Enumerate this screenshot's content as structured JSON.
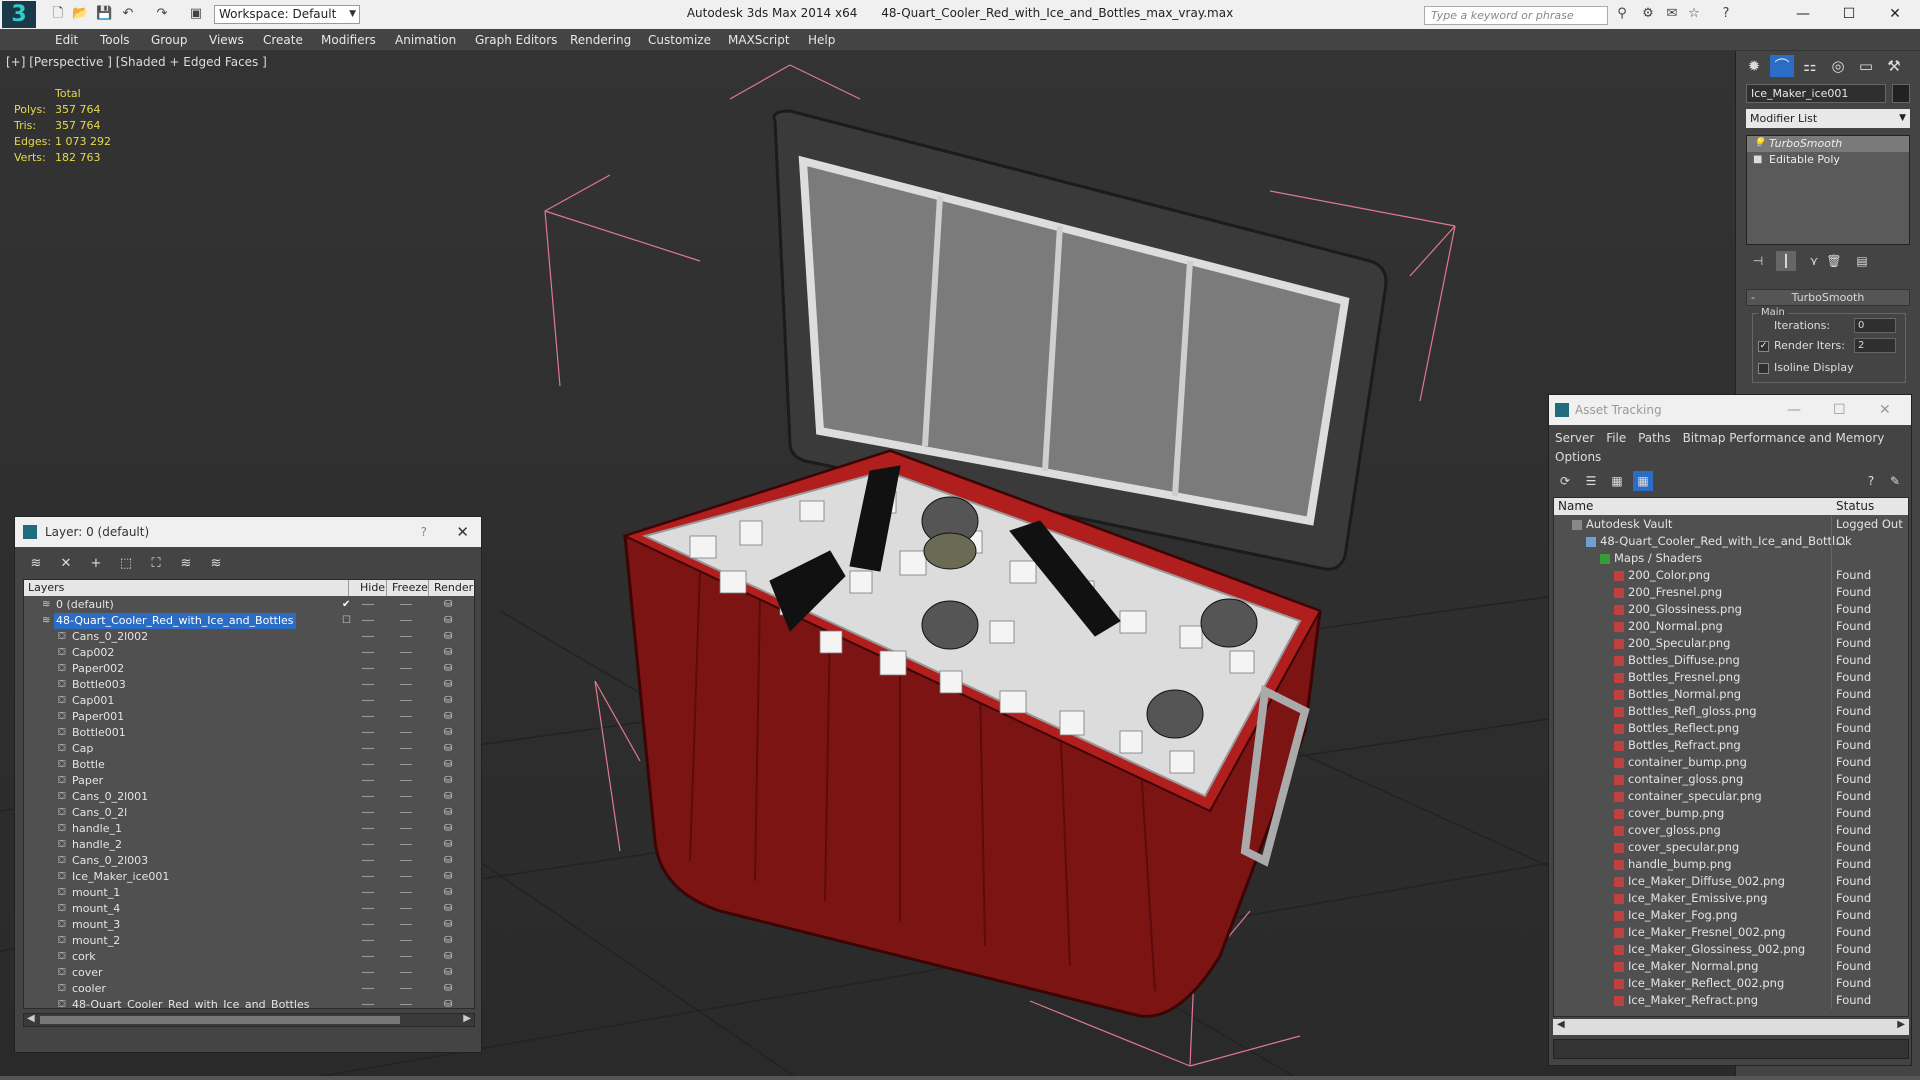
{
  "titlebar": {
    "workspace": "Workspace: Default",
    "app_name": "Autodesk 3ds Max  2014 x64",
    "file_name": "48-Quart_Cooler_Red_with_Ice_and_Bottles_max_vray.max",
    "search_placeholder": "Type a keyword or phrase"
  },
  "menu": [
    "Edit",
    "Tools",
    "Group",
    "Views",
    "Create",
    "Modifiers",
    "Animation",
    "Graph Editors",
    "Rendering",
    "Customize",
    "MAXScript",
    "Help"
  ],
  "viewport": {
    "label": "[+] [Perspective ] [Shaded + Edged Faces ]",
    "stats": {
      "header": "Total",
      "rows": [
        {
          "label": "Polys:",
          "value": "357 764"
        },
        {
          "label": "Tris:",
          "value": "357 764"
        },
        {
          "label": "Edges:",
          "value": "1 073 292"
        },
        {
          "label": "Verts:",
          "value": "182 763"
        }
      ]
    }
  },
  "command_panel": {
    "object_name": "Ice_Maker_ice001",
    "modifier_list": "Modifier List",
    "stack": [
      {
        "label": "TurboSmooth",
        "selected": true
      },
      {
        "label": "Editable Poly",
        "selected": false
      }
    ],
    "rollout_title": "TurboSmooth",
    "group_main": "Main",
    "iterations_label": "Iterations:",
    "iterations_value": "0",
    "render_iters_label": "Render Iters:",
    "render_iters_value": "2",
    "isoline_label": "Isoline Display"
  },
  "layer_dialog": {
    "title": "Layer: 0 (default)",
    "help": "?",
    "columns": {
      "layers": "Layers",
      "hide": "Hide",
      "freeze": "Freeze",
      "render": "Render"
    },
    "rows": [
      {
        "name": "0 (default)",
        "level": 0,
        "selected": false,
        "current": true
      },
      {
        "name": "48-Quart_Cooler_Red_with_Ice_and_Bottles",
        "level": 0,
        "selected": true,
        "current": false
      },
      {
        "name": "Cans_0_2l002",
        "level": 1
      },
      {
        "name": "Cap002",
        "level": 1
      },
      {
        "name": "Paper002",
        "level": 1
      },
      {
        "name": "Bottle003",
        "level": 1
      },
      {
        "name": "Cap001",
        "level": 1
      },
      {
        "name": "Paper001",
        "level": 1
      },
      {
        "name": "Bottle001",
        "level": 1
      },
      {
        "name": "Cap",
        "level": 1
      },
      {
        "name": "Bottle",
        "level": 1
      },
      {
        "name": "Paper",
        "level": 1
      },
      {
        "name": "Cans_0_2l001",
        "level": 1
      },
      {
        "name": "Cans_0_2l",
        "level": 1
      },
      {
        "name": "handle_1",
        "level": 1
      },
      {
        "name": "handle_2",
        "level": 1
      },
      {
        "name": "Cans_0_2l003",
        "level": 1
      },
      {
        "name": "Ice_Maker_ice001",
        "level": 1
      },
      {
        "name": "mount_1",
        "level": 1
      },
      {
        "name": "mount_4",
        "level": 1
      },
      {
        "name": "mount_3",
        "level": 1
      },
      {
        "name": "mount_2",
        "level": 1
      },
      {
        "name": "cork",
        "level": 1
      },
      {
        "name": "cover",
        "level": 1
      },
      {
        "name": "cooler",
        "level": 1
      },
      {
        "name": "48-Quart_Cooler_Red_with_Ice_and_Bottles",
        "level": 1
      }
    ]
  },
  "asset_tracking": {
    "title": "Asset Tracking",
    "menu": [
      "Server",
      "File",
      "Paths",
      "Bitmap Performance and Memory",
      "Options"
    ],
    "columns": {
      "name": "Name",
      "status": "Status"
    },
    "rows": [
      {
        "name": "Autodesk Vault",
        "status": "Logged Out",
        "level": 0,
        "icon": "vault"
      },
      {
        "name": "48-Quart_Cooler_Red_with_Ice_and_Bottl...",
        "status": "Ok",
        "level": 1,
        "icon": "file"
      },
      {
        "name": "Maps / Shaders",
        "status": "",
        "level": 2,
        "icon": "folder"
      },
      {
        "name": "200_Color.png",
        "status": "Found",
        "level": 3,
        "icon": "image"
      },
      {
        "name": "200_Fresnel.png",
        "status": "Found",
        "level": 3,
        "icon": "image"
      },
      {
        "name": "200_Glossiness.png",
        "status": "Found",
        "level": 3,
        "icon": "image"
      },
      {
        "name": "200_Normal.png",
        "status": "Found",
        "level": 3,
        "icon": "image"
      },
      {
        "name": "200_Specular.png",
        "status": "Found",
        "level": 3,
        "icon": "image"
      },
      {
        "name": "Bottles_Diffuse.png",
        "status": "Found",
        "level": 3,
        "icon": "image"
      },
      {
        "name": "Bottles_Fresnel.png",
        "status": "Found",
        "level": 3,
        "icon": "image"
      },
      {
        "name": "Bottles_Normal.png",
        "status": "Found",
        "level": 3,
        "icon": "image"
      },
      {
        "name": "Bottles_Refl_gloss.png",
        "status": "Found",
        "level": 3,
        "icon": "image"
      },
      {
        "name": "Bottles_Reflect.png",
        "status": "Found",
        "level": 3,
        "icon": "image"
      },
      {
        "name": "Bottles_Refract.png",
        "status": "Found",
        "level": 3,
        "icon": "image"
      },
      {
        "name": "container_bump.png",
        "status": "Found",
        "level": 3,
        "icon": "image"
      },
      {
        "name": "container_gloss.png",
        "status": "Found",
        "level": 3,
        "icon": "image"
      },
      {
        "name": "container_specular.png",
        "status": "Found",
        "level": 3,
        "icon": "image"
      },
      {
        "name": "cover_bump.png",
        "status": "Found",
        "level": 3,
        "icon": "image"
      },
      {
        "name": "cover_gloss.png",
        "status": "Found",
        "level": 3,
        "icon": "image"
      },
      {
        "name": "cover_specular.png",
        "status": "Found",
        "level": 3,
        "icon": "image"
      },
      {
        "name": "handle_bump.png",
        "status": "Found",
        "level": 3,
        "icon": "image"
      },
      {
        "name": "Ice_Maker_Diffuse_002.png",
        "status": "Found",
        "level": 3,
        "icon": "image"
      },
      {
        "name": "Ice_Maker_Emissive.png",
        "status": "Found",
        "level": 3,
        "icon": "image"
      },
      {
        "name": "Ice_Maker_Fog.png",
        "status": "Found",
        "level": 3,
        "icon": "image"
      },
      {
        "name": "Ice_Maker_Fresnel_002.png",
        "status": "Found",
        "level": 3,
        "icon": "image"
      },
      {
        "name": "Ice_Maker_Glossiness_002.png",
        "status": "Found",
        "level": 3,
        "icon": "image"
      },
      {
        "name": "Ice_Maker_Normal.png",
        "status": "Found",
        "level": 3,
        "icon": "image"
      },
      {
        "name": "Ice_Maker_Reflect_002.png",
        "status": "Found",
        "level": 3,
        "icon": "image"
      },
      {
        "name": "Ice_Maker_Refract.png",
        "status": "Found",
        "level": 3,
        "icon": "image"
      }
    ]
  },
  "colors": {
    "selection": "#2b6cc4",
    "stats_text": "#e6d94c",
    "cooler_red": "#8a1a1a",
    "bbox_pink": "#e07890"
  }
}
